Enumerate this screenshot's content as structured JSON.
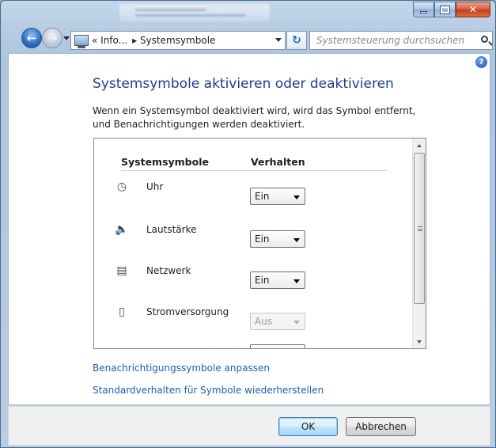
{
  "navigation": {
    "breadcrumbs": [
      "« Info...",
      "▸ Systemsymbole"
    ],
    "search_placeholder": "Systemsteuerung durchsuchen"
  },
  "page": {
    "title": "Systemsymbole aktivieren oder deaktivieren",
    "description": "Wenn ein Systemsymbol deaktiviert wird, wird das Symbol entfernt, und Benachrichtigungen werden deaktiviert."
  },
  "list": {
    "col_symbols": "Systemsymbole",
    "col_behavior": "Verhalten",
    "rows": [
      {
        "label": "Uhr",
        "value": "Ein",
        "icon": "clock-icon",
        "enabled": true
      },
      {
        "label": "Lautstärke",
        "value": "Ein",
        "icon": "speaker-icon",
        "enabled": true
      },
      {
        "label": "Netzwerk",
        "value": "Ein",
        "icon": "network-icon",
        "enabled": true
      },
      {
        "label": "Stromversorgung",
        "value": "Aus",
        "icon": "power-icon",
        "enabled": false
      }
    ]
  },
  "links": {
    "customize": "Benachrichtigungssymbole anpassen",
    "restore": "Standardverhalten für Symbole wiederherstellen"
  },
  "buttons": {
    "ok": "OK",
    "cancel": "Abbrechen"
  },
  "colors": {
    "title_blue": "#1e3f8a",
    "link_blue": "#1b5fb4"
  }
}
